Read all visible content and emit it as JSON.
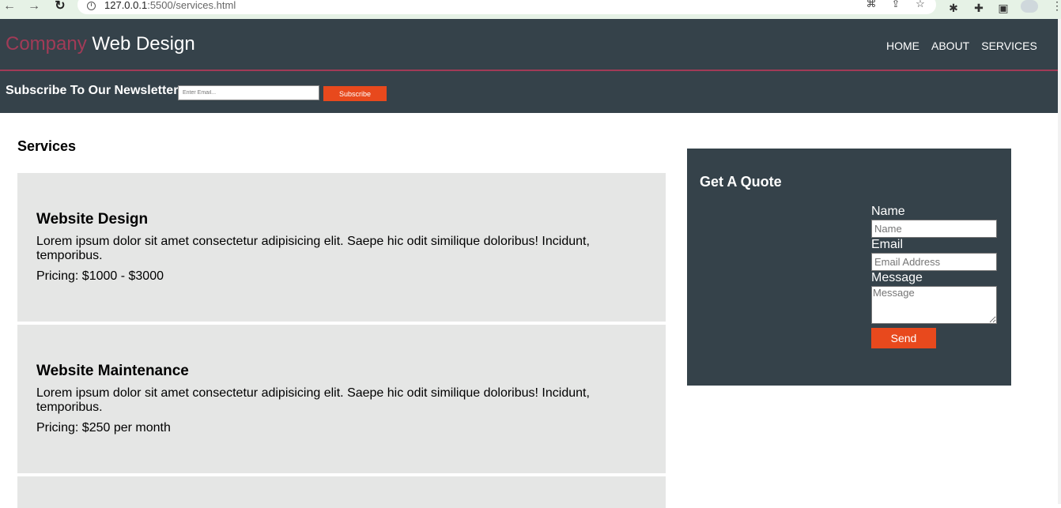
{
  "browser": {
    "url_host": "127.0.0.1",
    "url_rest": ":5500/services.html",
    "icons": [
      "back-arrow-icon",
      "forward-arrow-icon",
      "reload-icon",
      "info-icon",
      "translate-icon",
      "share-icon",
      "star-icon",
      "bug-icon",
      "puzzle-icon",
      "sidebar-icon",
      "avatar",
      "menu-dots-icon"
    ]
  },
  "header": {
    "logo_highlight": "Company",
    "logo_rest": " Web Design",
    "nav": [
      {
        "label": "HOME"
      },
      {
        "label": "ABOUT"
      },
      {
        "label": "SERVICES"
      }
    ]
  },
  "newsletter": {
    "title": "Subscribe To Our Newsletter",
    "placeholder": "Enter Email...",
    "button_label": "Subscribe"
  },
  "services": {
    "heading": "Services",
    "items": [
      {
        "title": "Website Design",
        "description": "Lorem ipsum dolor sit amet consectetur adipisicing elit. Saepe hic odit similique doloribus! Incidunt, temporibus.",
        "pricing": "Pricing: $1000 - $3000"
      },
      {
        "title": "Website Maintenance",
        "description": "Lorem ipsum dolor sit amet consectetur adipisicing elit. Saepe hic odit similique doloribus! Incidunt, temporibus.",
        "pricing": "Pricing: $250 per month"
      }
    ]
  },
  "quote": {
    "title": "Get A Quote",
    "name_label": "Name",
    "name_placeholder": "Name",
    "email_label": "Email",
    "email_placeholder": "Email Address",
    "message_label": "Message",
    "message_placeholder": "Message",
    "send_label": "Send"
  },
  "colors": {
    "header_bg": "#35424a",
    "accent": "#e8491d",
    "highlight": "#a13b57",
    "card_bg": "#e5e6e5"
  }
}
